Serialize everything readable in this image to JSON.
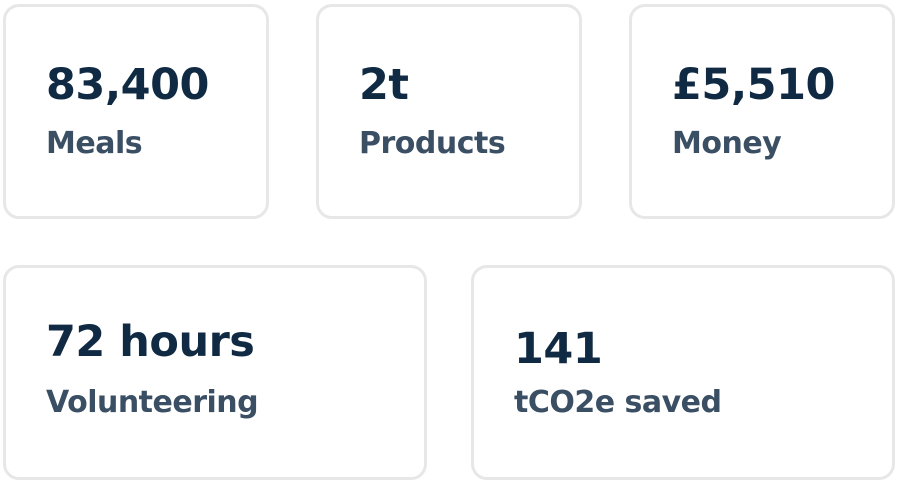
{
  "stats": [
    {
      "value": "83,400",
      "label": "Meals"
    },
    {
      "value": "2t",
      "label": "Products"
    },
    {
      "value": "£5,510",
      "label": "Money"
    },
    {
      "value": "72 hours",
      "label": "Volunteering"
    },
    {
      "value": "141",
      "label": "tCO2e saved"
    }
  ],
  "colors": {
    "value_text": "#102a43",
    "label_text": "#3b4f64",
    "card_border": "#e7e7e7",
    "background": "#ffffff"
  }
}
